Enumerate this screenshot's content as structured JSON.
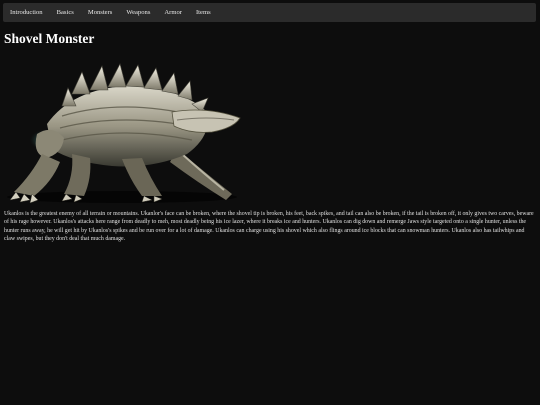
{
  "nav": {
    "items": [
      {
        "label": "Introduction"
      },
      {
        "label": "Basics"
      },
      {
        "label": "Monsters"
      },
      {
        "label": "Weapons"
      },
      {
        "label": "Armor"
      },
      {
        "label": "Items"
      }
    ]
  },
  "page": {
    "title": "Shovel Monster",
    "description": "Ukanlos is the greatest enemy of all terrain or mountains. Ukanlor's face can be broken, where the shovel tip is broken, his feet, back spikes, and tail can also be broken, if the tail is broken off, it only gives two carves, beware of his rage however. Ukanlos's attacks here range from deadly to meh, most deadly being his ice lazer, where it breaks ice and hunters. Ukanlos can dig down and remerge Jaws style targeted onto a single hunter, unless the hunter runs away, he will get hit by Ukanlos's spikes and be run over for a lot of damage. Ukanlos can charge using his shovel which also flings around ice blocks that can snowman hunters. Ukanlos also has tailwhips and claw swipes, but they don't deal that much damage."
  },
  "image": {
    "subject": "ukanlos-monster-render"
  }
}
